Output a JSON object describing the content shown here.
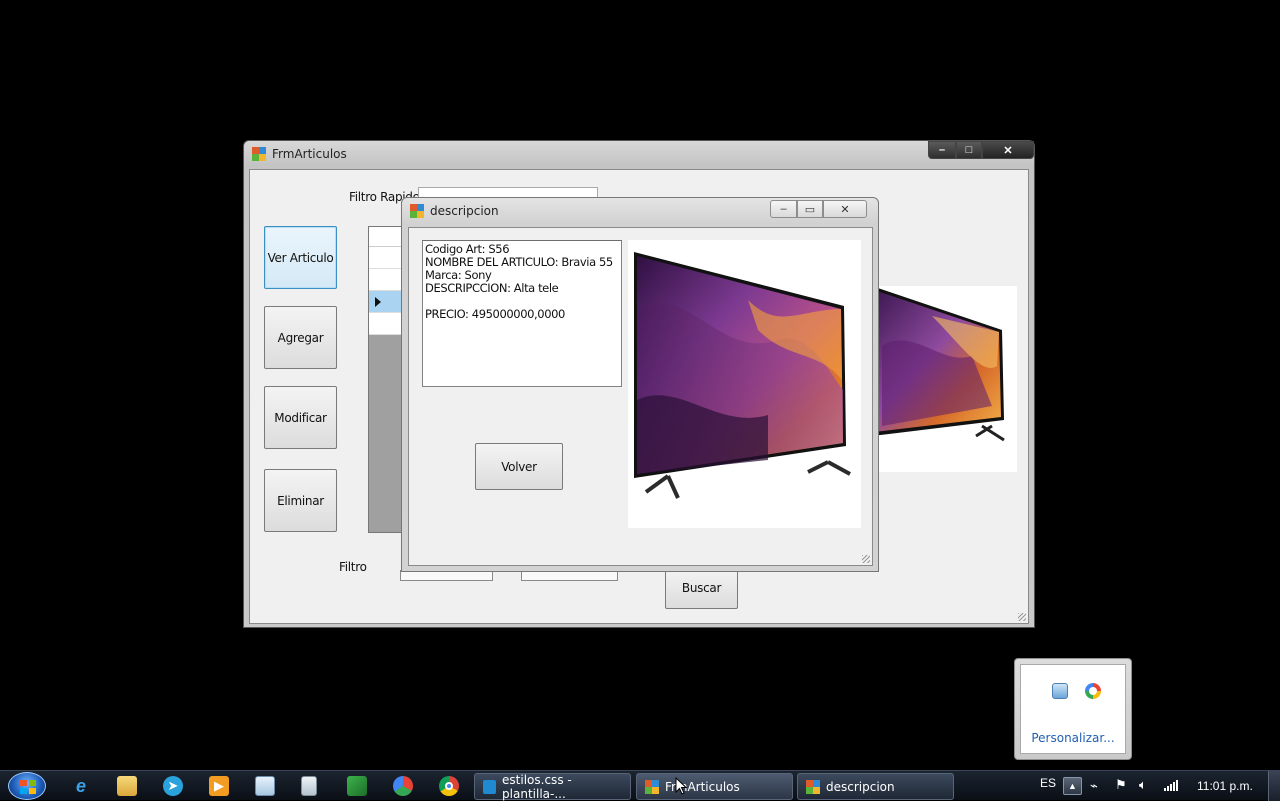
{
  "main_window": {
    "title": "FrmArticulos",
    "filtro_rapido_label": "Filtro Rapido",
    "filtro_rapido_value": "",
    "buttons": {
      "ver_articulo": "Ver Articulo",
      "agregar": "Agregar",
      "modificar": "Modificar",
      "eliminar": "Eliminar",
      "buscar": "Buscar"
    },
    "filtro_label": "Filtro",
    "caption": {
      "minimize": "–",
      "maximize": "□",
      "close": "✕"
    }
  },
  "dialog": {
    "title": "descripcion",
    "details": {
      "codigo": "Codigo Art: S56",
      "nombre": "NOMBRE DEL ARTICULO: Bravia 55",
      "marca": "Marca: Sony",
      "descripcion": "DESCRIPCCION: Alta tele",
      "precio": "PRECIO: 495000000,0000"
    },
    "volver_label": "Volver",
    "caption": {
      "minimize": "–",
      "maximize": "▭",
      "close": "✕"
    }
  },
  "taskbar": {
    "pinned_icons": [
      "internet-explorer-icon",
      "file-explorer-icon",
      "telegram-icon",
      "media-player-icon",
      "notepad-icon",
      "calculator-icon",
      "app-icon",
      "browser-icon",
      "chrome-icon"
    ],
    "tasks": [
      {
        "label": "estilos.css - plantilla-..."
      },
      {
        "label": "FrmArticulos"
      },
      {
        "label": "descripcion"
      }
    ],
    "language": "ES",
    "time": "11:01 p.m."
  },
  "tray_popup": {
    "customize_label": "Personalizar..."
  },
  "colors": {
    "accent_focus": "#3c8fc2",
    "link_blue": "#1f5fb4",
    "grid_selected_row": "#a9d3f0"
  }
}
